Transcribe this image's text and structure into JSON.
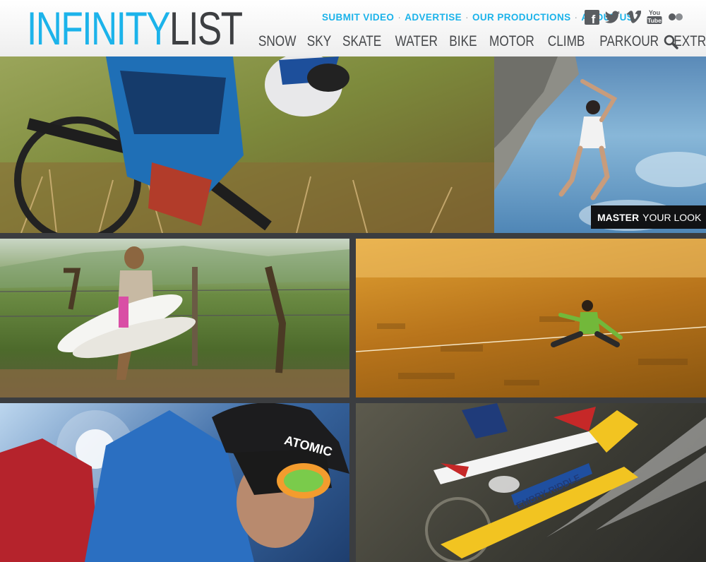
{
  "brand": {
    "logo_part1": "INFINITY",
    "logo_part2": "LIST"
  },
  "top_links": [
    {
      "label": "SUBMIT VIDEO"
    },
    {
      "label": "ADVERTISE"
    },
    {
      "label": "OUR PRODUCTIONS"
    },
    {
      "label": "ABOUT US"
    }
  ],
  "top_link_separator": "·",
  "social": {
    "facebook": "f",
    "youtube_line1": "You",
    "youtube_line2": "Tube"
  },
  "nav": [
    {
      "label": "SNOW"
    },
    {
      "label": "SKY"
    },
    {
      "label": "SKATE"
    },
    {
      "label": "WATER"
    },
    {
      "label": "BIKE"
    },
    {
      "label": "MOTOR"
    },
    {
      "label": "CLIMB"
    },
    {
      "label": "PARKOUR"
    },
    {
      "label": "EXTRA"
    }
  ],
  "ad_banner": {
    "bold": "MASTER",
    "regular": "YOUR LOOK"
  },
  "tiles": [
    {
      "photo_text": ""
    },
    {
      "photo_text": ""
    },
    {
      "photo_text": ""
    },
    {
      "photo_text": ""
    },
    {
      "photo_text": "ATOMIC"
    },
    {
      "photo_text": "EMBRY-RIDDLE"
    }
  ],
  "colors": {
    "accent": "#1cb3ea",
    "logo_dark": "#3d3f42",
    "nav_text": "#46484b",
    "gutter": "#3b3d40"
  }
}
